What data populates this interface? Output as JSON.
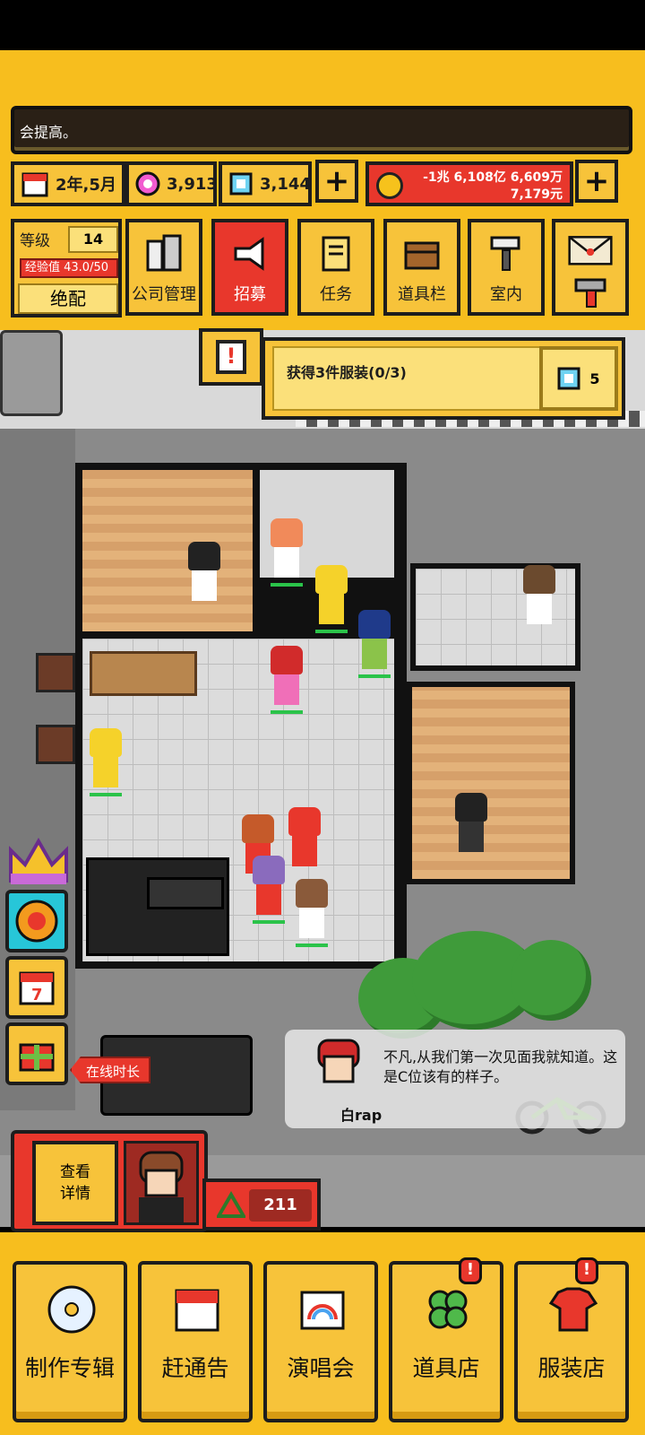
{
  "ticker": {
    "text": "会提高。"
  },
  "resources": {
    "date": "2年,5月",
    "pink_gems": "3,913",
    "diamonds": "3,144",
    "money_line1": "-1兆 6,108亿 6,609万",
    "money_line2": "7,179元"
  },
  "level": {
    "label": "等级",
    "value": "14",
    "exp": "经验值 43.0/50",
    "title": "绝配"
  },
  "top_menu": [
    {
      "label": "公司管理",
      "icon": "building-icon"
    },
    {
      "label": "招募",
      "icon": "megaphone-icon"
    },
    {
      "label": "任务",
      "icon": "scroll-icon"
    },
    {
      "label": "道具栏",
      "icon": "chest-icon"
    },
    {
      "label": "室内",
      "icon": "paint-roller-icon"
    }
  ],
  "quest": {
    "text": "获得3件服装(0/3)",
    "reward": "5"
  },
  "side": {
    "online_tag": "在线时长"
  },
  "dialog": {
    "speaker": "白rap",
    "line": "不凡,从我们第一次见面我就知道。这是C位该有的样子。"
  },
  "artist": {
    "detail_label": "查看\n详情",
    "fans": "211"
  },
  "bottom_nav": [
    {
      "label": "制作专辑",
      "icon": "cd-icon"
    },
    {
      "label": "赶通告",
      "icon": "calendar-icon"
    },
    {
      "label": "演唱会",
      "icon": "rainbow-icon"
    },
    {
      "label": "道具店",
      "icon": "clover-icon"
    },
    {
      "label": "服装店",
      "icon": "shirt-icon"
    }
  ],
  "colors": {
    "hud_yellow": "#f7be1e",
    "accent_red": "#e8372c",
    "outline": "#1d1d1d"
  }
}
